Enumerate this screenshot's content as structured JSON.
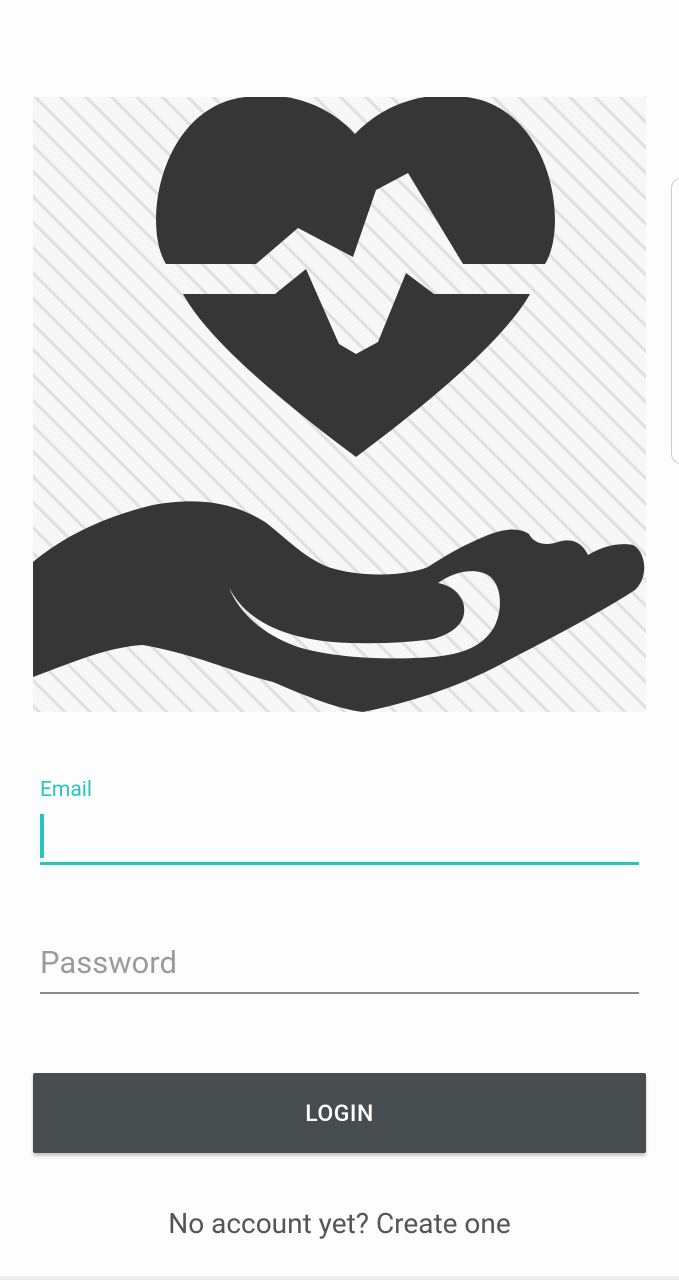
{
  "logo": {
    "icon": "hand-holding-heart-pulse-icon",
    "colors": {
      "shape": "#363636",
      "stripes": "#dddddd",
      "background": "#f7f7f7"
    }
  },
  "login_form": {
    "email": {
      "label": "Email",
      "value": ""
    },
    "password": {
      "placeholder": "Password",
      "value": ""
    },
    "login_button_label": "LOGIN",
    "signup_link_text": "No account yet? Create one"
  },
  "colors": {
    "accent": "#26c6bb",
    "button": "#474d4e",
    "button_text": "#ffffff",
    "muted_text": "#9b9b9b",
    "link_text": "#555555"
  }
}
